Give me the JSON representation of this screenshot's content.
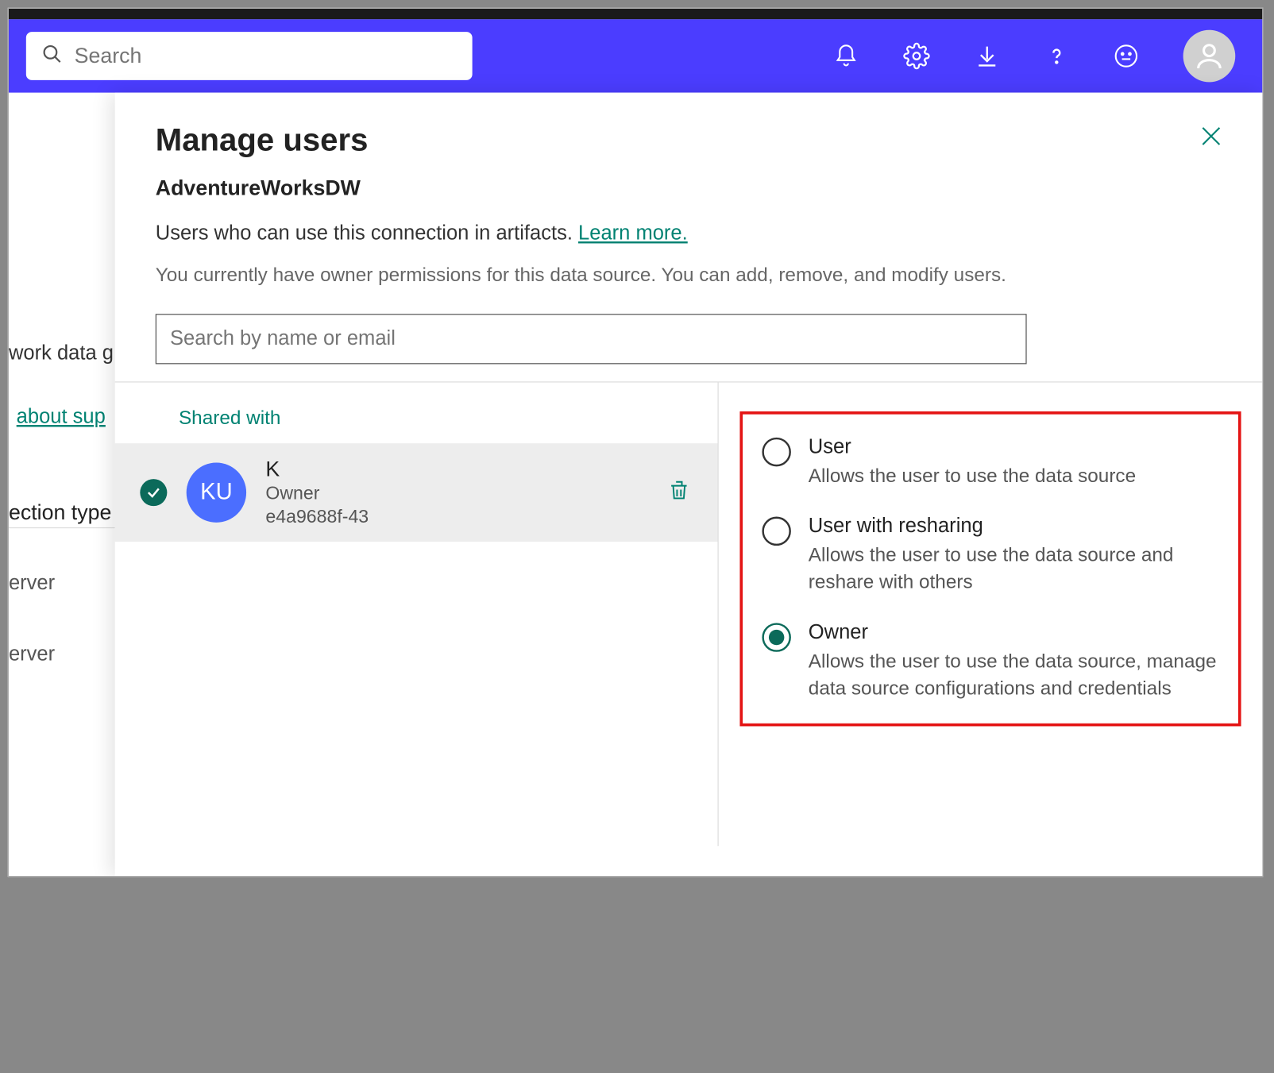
{
  "topbar": {
    "search_placeholder": "Search"
  },
  "background": {
    "line1": "work data g",
    "link": "about sup",
    "heading": "ection type",
    "srv1": "erver",
    "srv2": "erver"
  },
  "panel": {
    "title": "Manage users",
    "subtitle": "AdventureWorksDW",
    "desc_prefix": "Users who can use this connection in artifacts. ",
    "learn_more": "Learn more.",
    "note": "You currently have owner permissions for this data source. You can add, remove, and modify users.",
    "search_placeholder": "Search by name or email",
    "shared_with": "Shared with"
  },
  "user": {
    "initials": "KU",
    "name": "K",
    "role": "Owner",
    "id": "e4a9688f-43"
  },
  "roles": [
    {
      "title": "User",
      "desc": "Allows the user to use the data source",
      "selected": false
    },
    {
      "title": "User with resharing",
      "desc": "Allows the user to use the data source and reshare with others",
      "selected": false
    },
    {
      "title": "Owner",
      "desc": "Allows the user to use the data source, manage data source configurations and credentials",
      "selected": true
    }
  ]
}
